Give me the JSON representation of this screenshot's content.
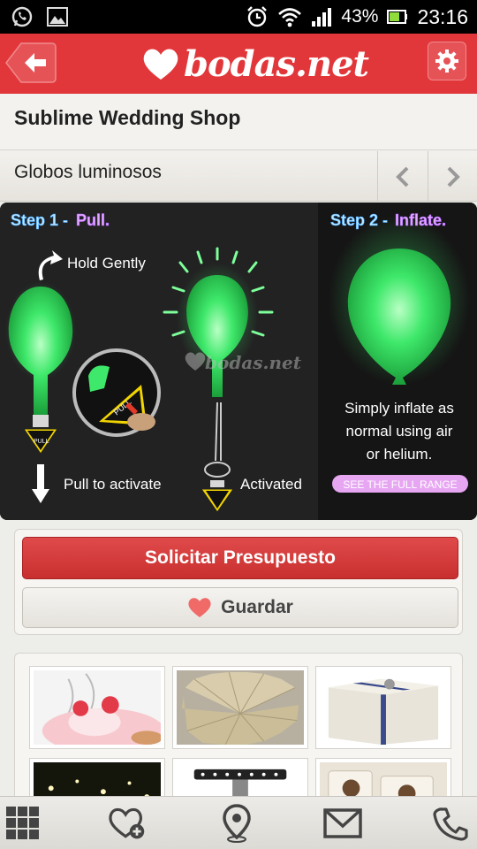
{
  "status_bar": {
    "battery_percent": "43%",
    "time": "23:16",
    "icons": [
      "whatsapp-icon",
      "gallery-icon",
      "alarm-icon",
      "wifi-icon",
      "signal-icon",
      "battery-icon"
    ]
  },
  "header": {
    "logo_text": "bodas.net",
    "back_icon": "arrow-left-icon",
    "settings_icon": "gear-icon",
    "accent_color": "#e2373a"
  },
  "shop": {
    "title": "Sublime Wedding Shop"
  },
  "gallery": {
    "title": "Globos luminosos",
    "prev_icon": "chevron-left-icon",
    "next_icon": "chevron-right-icon"
  },
  "hero": {
    "step1_label": "Step 1 -",
    "step1_action": "Pull.",
    "step2_label": "Step 2 -",
    "step2_action": "Inflate.",
    "hold_gently": "Hold Gently",
    "pull_to_activate": "Pull to activate",
    "activated": "Activated",
    "pull_tag": "PULL",
    "watermark": "bodas.net",
    "inflate_line1": "Simply inflate as",
    "inflate_line2": "normal using air",
    "inflate_line3": "or helium.",
    "full_range": "SEE THE FULL RANGE",
    "balloon_color": "#3ee86a"
  },
  "actions": {
    "quote_label": "Solicitar Presupuesto",
    "save_label": "Guardar",
    "save_icon": "heart-icon"
  },
  "thumbnails": [
    {
      "name": "thumb-cupcake"
    },
    {
      "name": "thumb-paper-fan"
    },
    {
      "name": "thumb-gift-box"
    },
    {
      "name": "thumb-night-lights"
    },
    {
      "name": "thumb-cake-stand"
    },
    {
      "name": "thumb-chocolates"
    }
  ],
  "bottom_nav": [
    {
      "name": "grid-icon"
    },
    {
      "name": "heart-add-icon"
    },
    {
      "name": "location-pin-icon"
    },
    {
      "name": "mail-icon"
    },
    {
      "name": "phone-icon"
    }
  ]
}
